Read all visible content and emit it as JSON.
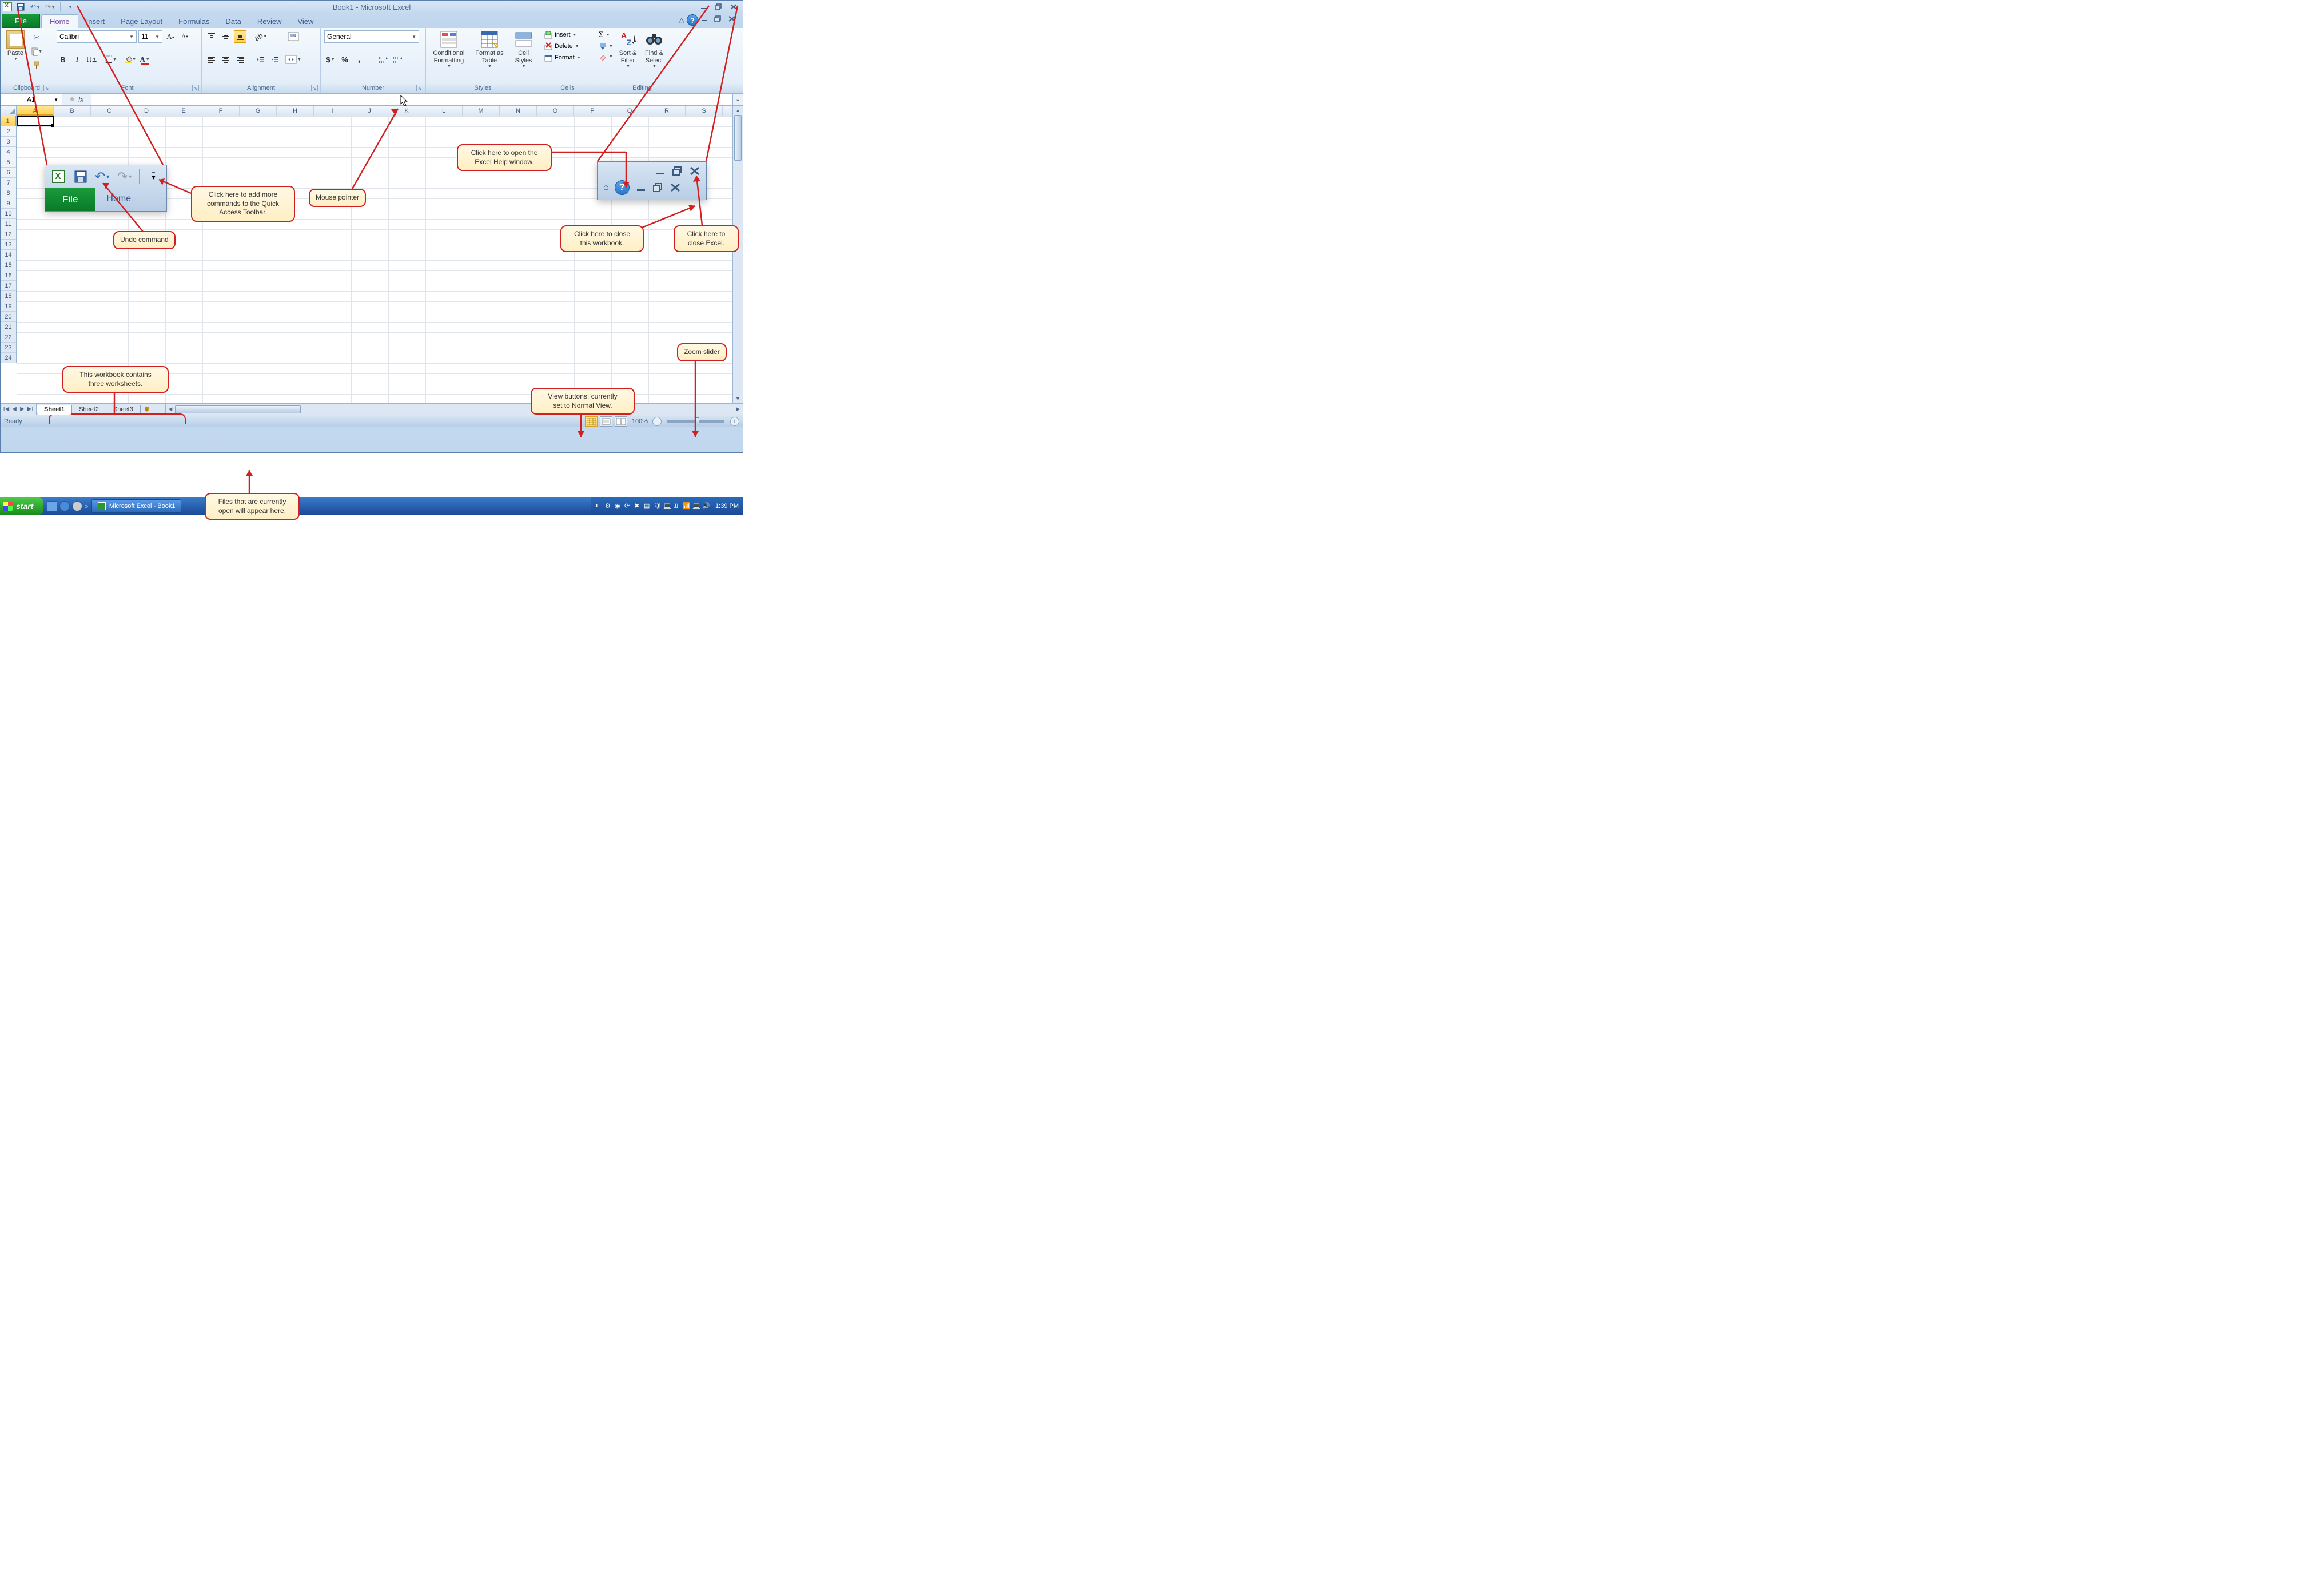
{
  "title": "Book1 - Microsoft Excel",
  "qat": {
    "save": "💾",
    "undo": "↶",
    "redo": "↷"
  },
  "tabs": {
    "file": "File",
    "active": "Home",
    "others": [
      "Insert",
      "Page Layout",
      "Formulas",
      "Data",
      "Review",
      "View"
    ]
  },
  "ribbon": {
    "clipboard": {
      "label": "Clipboard",
      "paste": "Paste"
    },
    "font": {
      "label": "Font",
      "name": "Calibri",
      "size": "11",
      "bold": "B",
      "italic": "I",
      "underline": "U"
    },
    "alignment": {
      "label": "Alignment"
    },
    "number": {
      "label": "Number",
      "format": "General"
    },
    "styles": {
      "label": "Styles",
      "cond": "Conditional\nFormatting",
      "table": "Format as\nTable",
      "cell": "Cell\nStyles"
    },
    "cells": {
      "label": "Cells",
      "insert": "Insert",
      "delete": "Delete",
      "format": "Format"
    },
    "editing": {
      "label": "Editing",
      "sort": "Sort &\nFilter",
      "find": "Find &\nSelect"
    }
  },
  "namebox": "A1",
  "columns": [
    "A",
    "B",
    "C",
    "D",
    "E",
    "F",
    "G",
    "H",
    "I",
    "J",
    "K",
    "L",
    "M",
    "N",
    "O",
    "P",
    "Q",
    "R",
    "S"
  ],
  "rows": [
    "1",
    "2",
    "3",
    "4",
    "5",
    "6",
    "7",
    "8",
    "9",
    "10",
    "11",
    "12",
    "13",
    "14",
    "15",
    "16",
    "17",
    "18",
    "19",
    "20",
    "21",
    "22",
    "23",
    "24"
  ],
  "sheets": {
    "active": "Sheet1",
    "others": [
      "Sheet2",
      "Sheet3"
    ]
  },
  "status": {
    "ready": "Ready",
    "zoom": "100%"
  },
  "taskbar": {
    "start": "start",
    "app": "Microsoft Excel - Book1",
    "time": "1:39 PM"
  },
  "callouts": {
    "qat": "Click here to add more\ncommands to the Quick\nAccess Toolbar.",
    "undo": "Undo command",
    "mouse": "Mouse pointer",
    "help": "Click here to open the\nExcel Help window.",
    "closewb": "Click here to close\nthis workbook.",
    "closeexcel": "Click here to\nclose Excel.",
    "sheets": "This workbook contains\nthree worksheets.",
    "views": "View buttons; currently\nset to Normal View.",
    "zoom": "Zoom slider",
    "files": "Files that are currently\nopen will appear here."
  },
  "inset": {
    "file": "File",
    "home": "Home"
  }
}
